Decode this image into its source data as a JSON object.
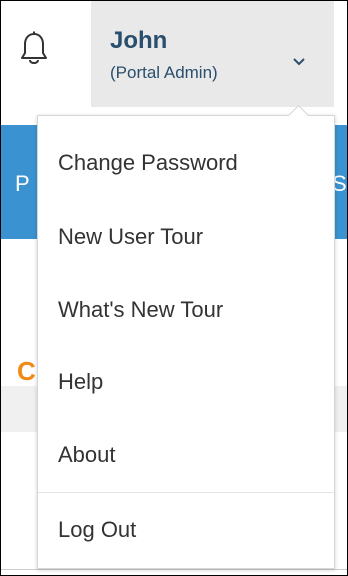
{
  "header": {
    "notifications_icon": "bell-icon",
    "user": {
      "name": "John",
      "role": "(Portal Admin)",
      "chevron_icon": "chevron-down-icon"
    }
  },
  "background": {
    "nav_left_char": "P",
    "nav_right_char": "S",
    "section_char": "C",
    "accent_color": "#3a93d0",
    "orange_color": "#f08a14"
  },
  "menu": {
    "items": [
      {
        "label": "Change Password"
      },
      {
        "label": "New User Tour"
      },
      {
        "label": "What's New Tour"
      },
      {
        "label": "Help"
      },
      {
        "label": "About"
      },
      {
        "label": "Log Out"
      }
    ]
  }
}
